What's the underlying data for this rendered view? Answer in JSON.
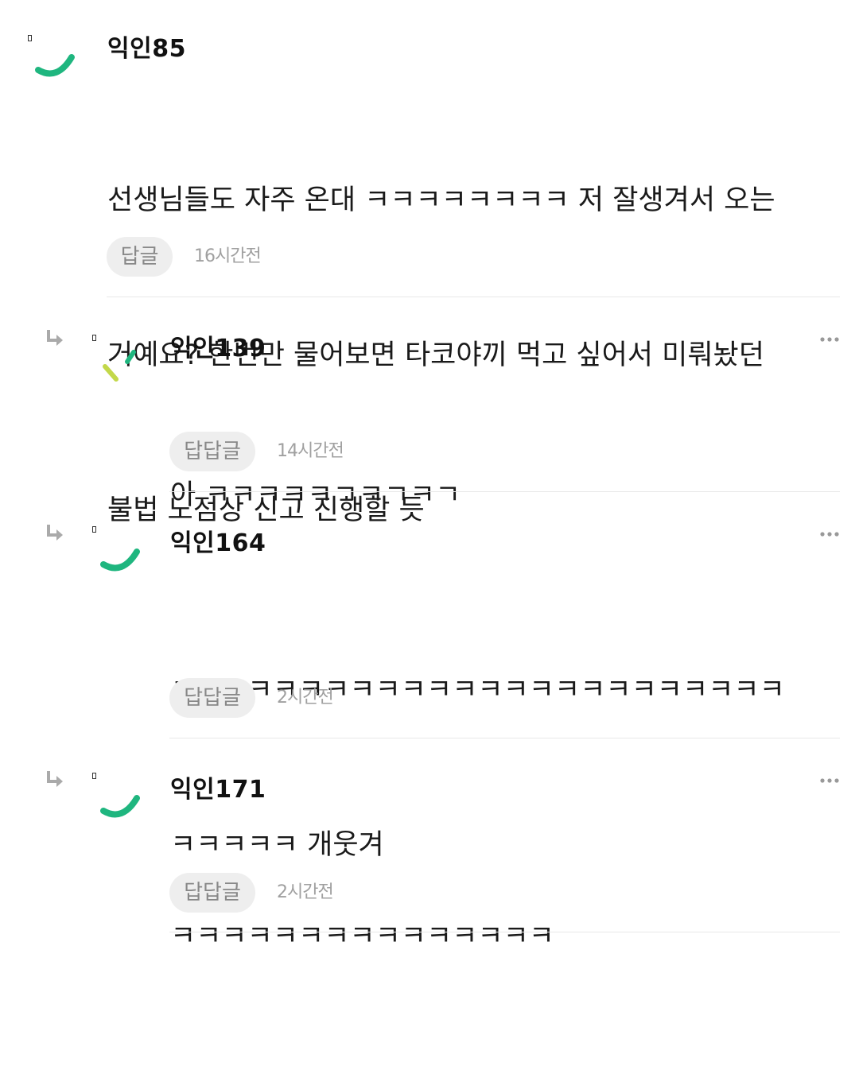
{
  "comments": [
    {
      "author": "익인85",
      "lines": [
        "선생님들도 자주 온대 ㅋㅋㅋㅋㅋㅋㅋㅋ 저 잘생겨서 오는",
        "거예요? 한번만 물어보면 타코야끼 먹고 싶어서 미뤄놨던",
        "불법 노점상 신고 진행할 듯"
      ],
      "reply_label": "답글",
      "time": "16시간전",
      "avatar_color": "#1fb67f"
    },
    {
      "author": "익인139",
      "lines": [
        "아 ㅋㅋㅋㅋㅋㄱㅋㄱㅋㄱ"
      ],
      "reply_label": "답답글",
      "time": "14시간전",
      "avatar_color": "#b5d334"
    },
    {
      "author": "익인164",
      "lines": [
        "ㅋㅋㅋㅋㅋㅋㅋㅋㅋㅋㅋㅋㅋㅋㅋㅋㅋㅋㅋㅋㅋㅋㅋㅋ",
        "ㅋㅋㅋㅋㅋ 개웃겨"
      ],
      "reply_label": "답답글",
      "time": "2시간전",
      "avatar_color": "#1fb67f"
    },
    {
      "author": "익인171",
      "lines": [
        "ㅋㅋㅋㅋㅋㅋㅋㅋㅋㅋㅋㅋㅋㅋㅋ"
      ],
      "reply_label": "답답글",
      "time": "2시간전",
      "avatar_color": "#1fb67f"
    }
  ]
}
